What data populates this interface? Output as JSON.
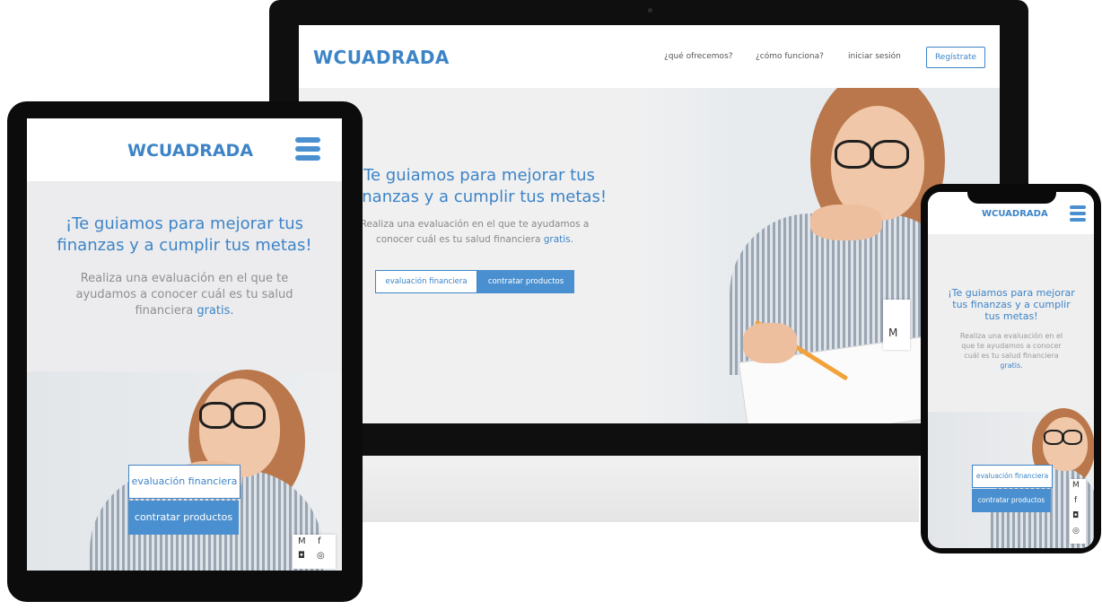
{
  "desktop": {
    "logo": "WCUADRADA",
    "nav_links": [
      "¿qué ofrecemos?",
      "¿cómo funciona?",
      "iniciar sesión"
    ],
    "register_button": "Regístrate",
    "hero_title": "Te guiamos para mejorar tus finanzas y a cumplir tus metas!",
    "hero_subtitle": "Realiza una evaluación en el que te ayudamos a conocer cuál es tu salud financiera",
    "hero_subtitle_highlight": "gratis.",
    "button_evaluation": "evaluación financiera",
    "button_products": "contratar productos"
  },
  "tablet": {
    "logo": "WCUADRADA",
    "hero_title": "¡Te guiamos para mejorar tus finanzas y a cumplir tus metas!",
    "hero_subtitle": "Realiza una evaluación en el que te ayudamos a conocer cuál es tu salud financiera",
    "hero_subtitle_highlight": "gratis.",
    "button_evaluation": "evaluación financiera",
    "button_products": "contratar productos"
  },
  "phone": {
    "logo": "WCUADRADA",
    "hero_title": "¡Te guiamos para mejorar tus finanzas y a cumplir tus metas!",
    "hero_subtitle": "Realiza una evaluación en el que te ayudamos a conocer cuál es tu salud financiera",
    "hero_subtitle_highlight": "gratis.",
    "button_evaluation": "evaluación financiera",
    "button_products": "contratar productos"
  },
  "icons": [
    "gmail-icon",
    "facebook-icon",
    "instagram-icon",
    "whatsapp-icon",
    "menu-icon"
  ],
  "colors": {
    "brand_blue": "#3d84c7",
    "button_blue": "#4a90d0",
    "device_black": "#0f0f10"
  }
}
